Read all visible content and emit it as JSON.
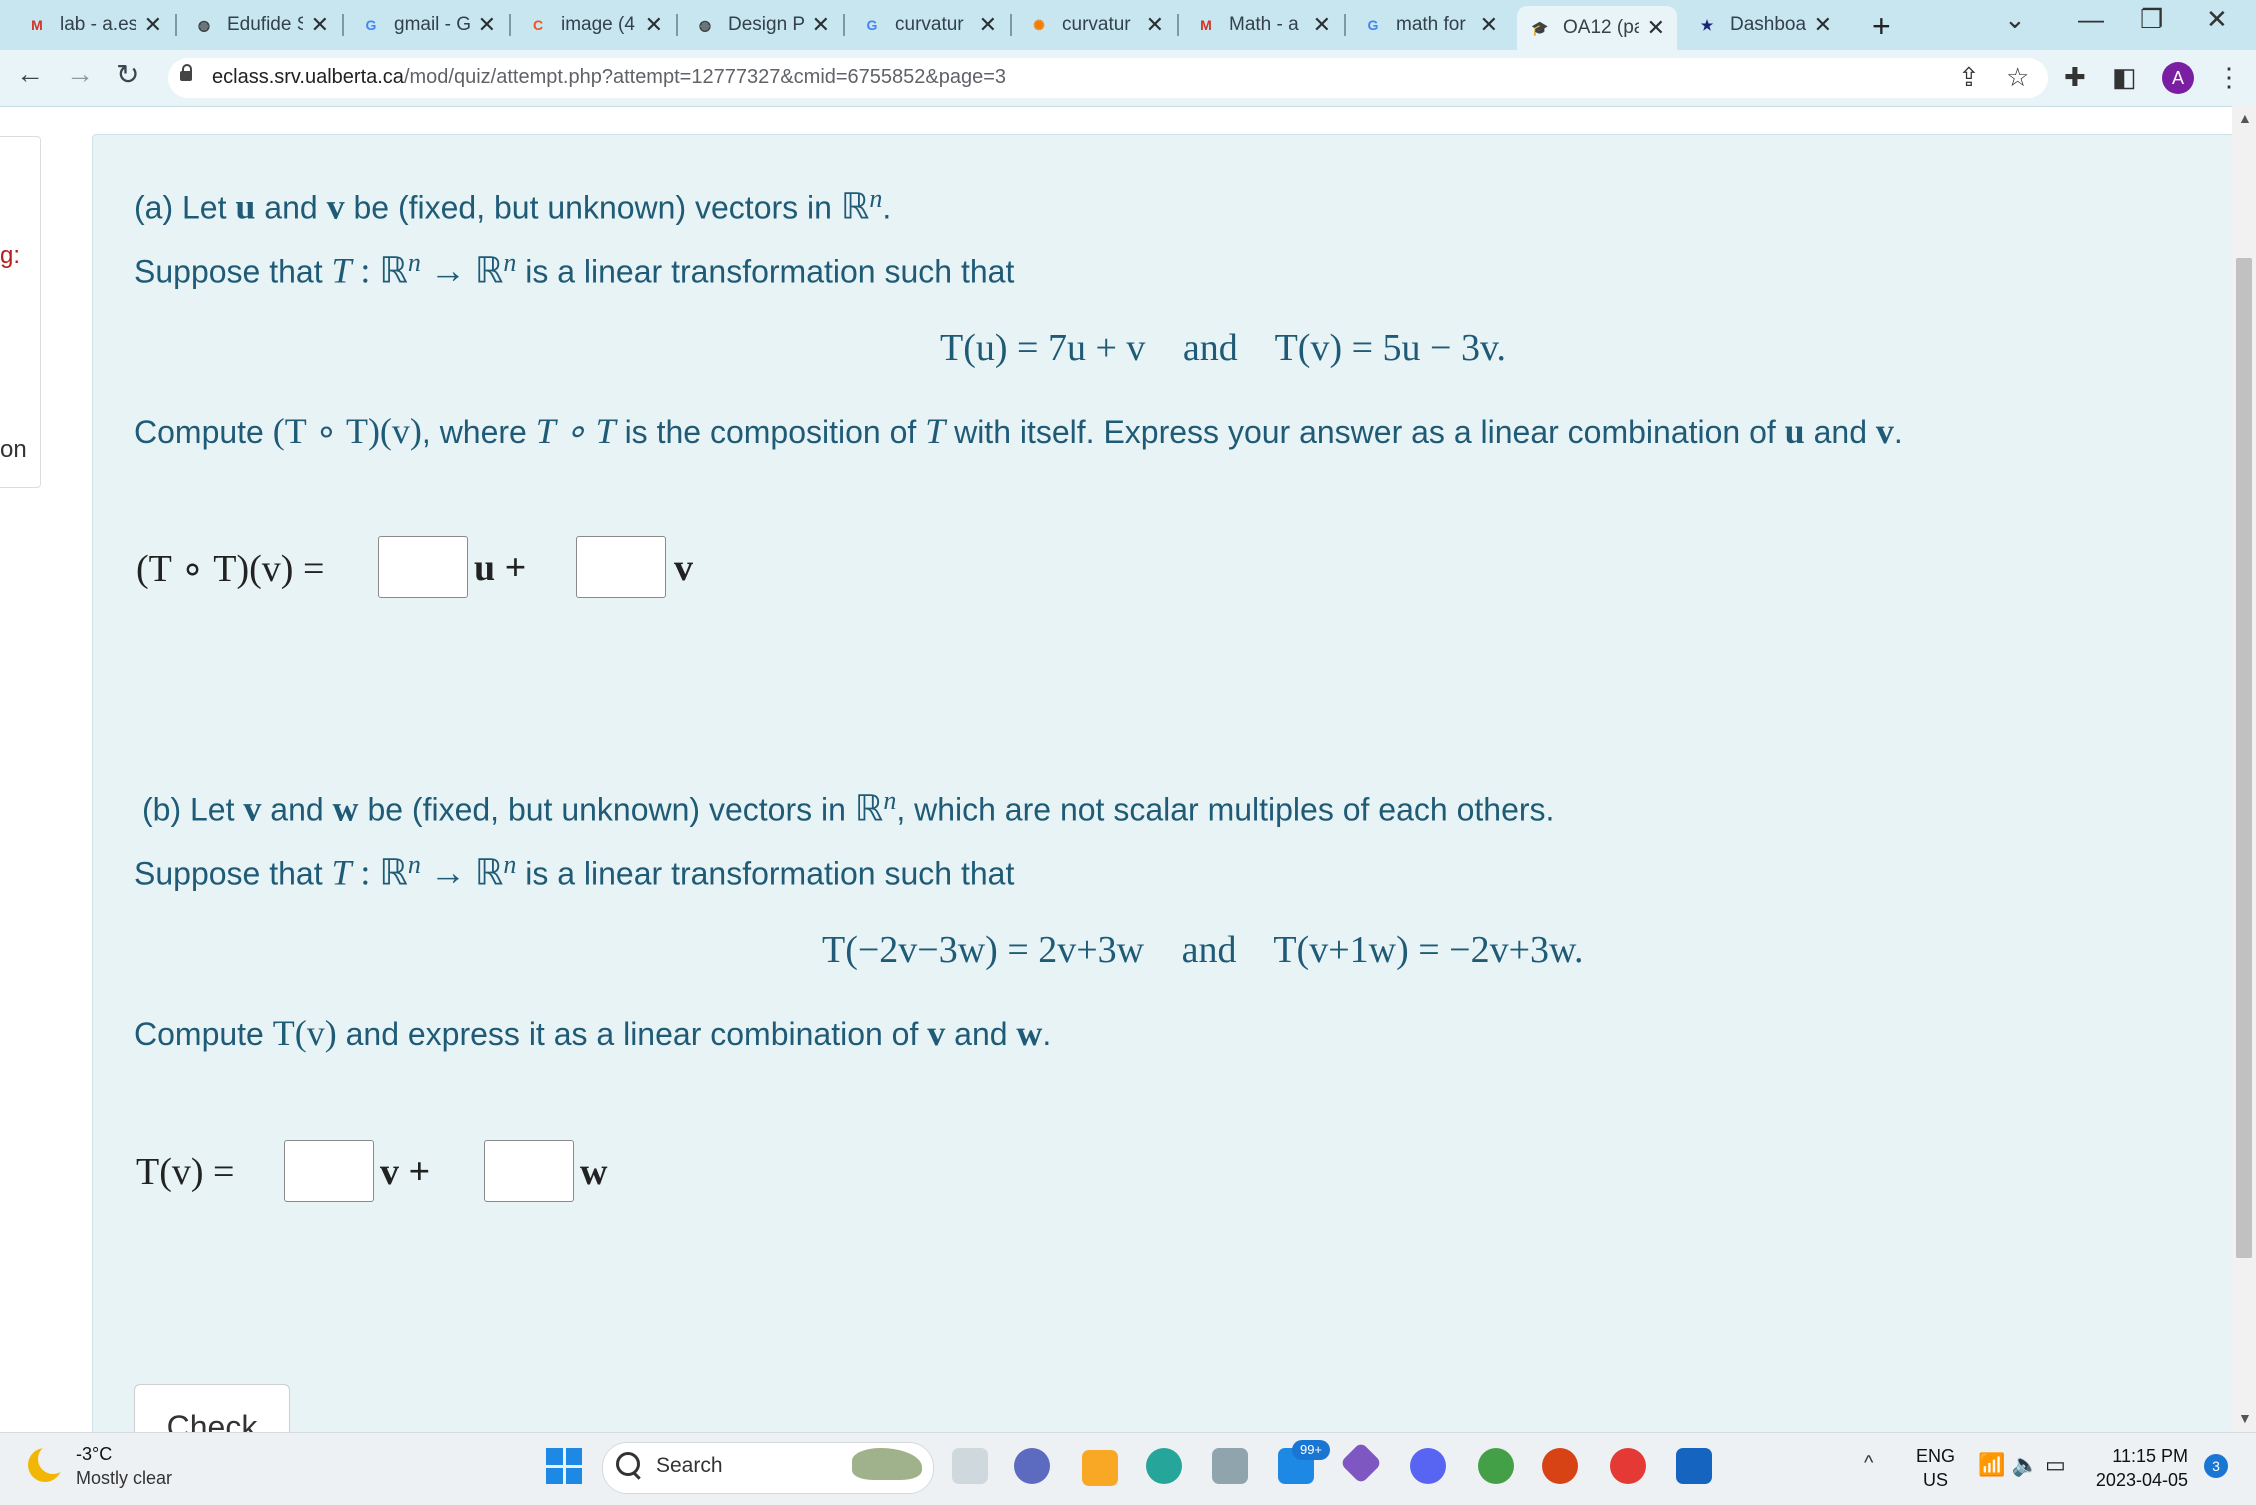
{
  "browser": {
    "tabs": [
      {
        "title": "lab - a.es",
        "icon": "gmail-icon",
        "color": "#d93025",
        "glyph": "M"
      },
      {
        "title": "Edufide S",
        "icon": "globe-icon",
        "color": "#3c4043",
        "glyph": "◍"
      },
      {
        "title": "gmail - G",
        "icon": "google-icon",
        "color": "#4285f4",
        "glyph": "G"
      },
      {
        "title": "image (4",
        "icon": "c-logo-icon",
        "color": "#f4511e",
        "glyph": "C"
      },
      {
        "title": "Design P",
        "icon": "globe-icon",
        "color": "#3c4043",
        "glyph": "◍"
      },
      {
        "title": "curvatur",
        "icon": "google-icon",
        "color": "#4285f4",
        "glyph": "G"
      },
      {
        "title": "curvatur",
        "icon": "sun-icon",
        "color": "#f57c00",
        "glyph": "✺"
      },
      {
        "title": "Math - a",
        "icon": "gmail-icon",
        "color": "#d93025",
        "glyph": "M"
      },
      {
        "title": "math for",
        "icon": "google-icon",
        "color": "#4285f4",
        "glyph": "G"
      },
      {
        "title": "OA12 (pa",
        "icon": "graduation-cap-icon",
        "color": "#0f6b3a",
        "glyph": "🎓"
      },
      {
        "title": "Dashboa",
        "icon": "star-badge-icon",
        "color": "#1a237e",
        "glyph": "★"
      }
    ],
    "active_tab_index": 9,
    "new_tab_label": "+",
    "url_host": "eclass.srv.ualberta.ca",
    "url_path": "/mod/quiz/attempt.php?attempt=12777327&cmid=6755852&page=3",
    "profile_initial": "A"
  },
  "page_edge": {
    "text1": "g:",
    "text2": "on"
  },
  "question_a": {
    "label": "(a) Let",
    "vec_u": "u",
    "and": "and",
    "vec_v": "v",
    "tail": "be (fixed, but unknown) vectors in",
    "space": "ℝ",
    "space_exp": "n",
    "period": ".",
    "suppose_pre": "Suppose that",
    "T": "T",
    "map": ": ℝ",
    "map2": "→ ℝ",
    "suppose_post": "is a linear transformation such that",
    "eq_left": "T(u) = 7u + v",
    "eq_and": "and",
    "eq_right": "T(v) = 5u − 3v.",
    "compute_pre": "Compute",
    "compute_expr": "(T ∘ T)(v)",
    "compute_mid": ", where",
    "compute_expr2": "T ∘ T",
    "compute_mid2": "is the composition of",
    "compute_mid3": "with itself. Express your answer as a linear combination of",
    "compute_end": ".",
    "answer_lhs": "(T ∘ T)(v) =",
    "answer_u": "u +",
    "answer_v": "v"
  },
  "question_b": {
    "label": "(b)  Let",
    "vec_v": "v",
    "and": "and",
    "vec_w": "w",
    "tail": "be (fixed, but unknown) vectors in",
    "space": "ℝ",
    "space_exp": "n",
    "tail2": ", which are not scalar multiples of each others.",
    "suppose_pre": "Suppose that",
    "T": "T",
    "map": ": ℝ",
    "map2": "→ ℝ",
    "suppose_post": "is a linear transformation such that",
    "eq_left": "T(−2v−3w) = 2v+3w",
    "eq_and": "and",
    "eq_right": "T(v+1w) = −2v+3w.",
    "compute_pre": "Compute",
    "compute_expr": "T(v)",
    "compute_mid": "and express it as a linear combination of",
    "compute_end": ".",
    "answer_lhs": "T(v) =",
    "answer_v": "v +",
    "answer_w": "w"
  },
  "check_button": "Check",
  "taskbar": {
    "temperature": "-3°C",
    "weather": "Mostly clear",
    "search_label": "Search",
    "mail_badge": "99+",
    "lang_top": "ENG",
    "lang_bottom": "US",
    "time": "11:15 PM",
    "date": "2023-04-05",
    "notifications": "3"
  }
}
